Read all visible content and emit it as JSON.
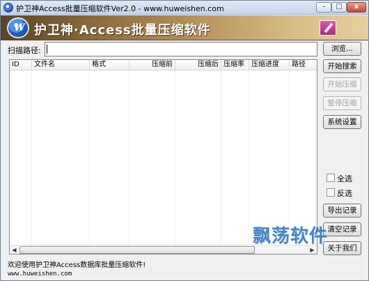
{
  "window": {
    "title": "护卫神Access批量压缩软件Ver2.0 - www.huweishen.com",
    "controls": {
      "minimize": "–",
      "maximize": "□",
      "close": "x"
    }
  },
  "banner": {
    "logo_letter": "W",
    "title": "护卫神·Access批量压缩软件",
    "tool_icon": "wrench-icon"
  },
  "path": {
    "label": "扫描路径:",
    "value": ""
  },
  "table": {
    "columns": [
      "ID",
      "文件名",
      "格式",
      "压缩前",
      "压缩后",
      "压缩率",
      "压缩进度",
      "路径"
    ],
    "rows": []
  },
  "buttons": {
    "browse": "浏览...",
    "start_search": "开始搜索",
    "start_compress": "开始压缩",
    "pause_compress": "暂停压缩",
    "settings": "系统设置",
    "export": "导出记录",
    "clear": "清空记录",
    "about": "关于我们"
  },
  "checkboxes": {
    "select_all": "全选",
    "invert": "反选"
  },
  "status": {
    "welcome": "欢迎使用护卫神Access数据库批量压缩软件!",
    "website": "www.huweishen.com"
  },
  "watermark": "飘荡软件"
}
